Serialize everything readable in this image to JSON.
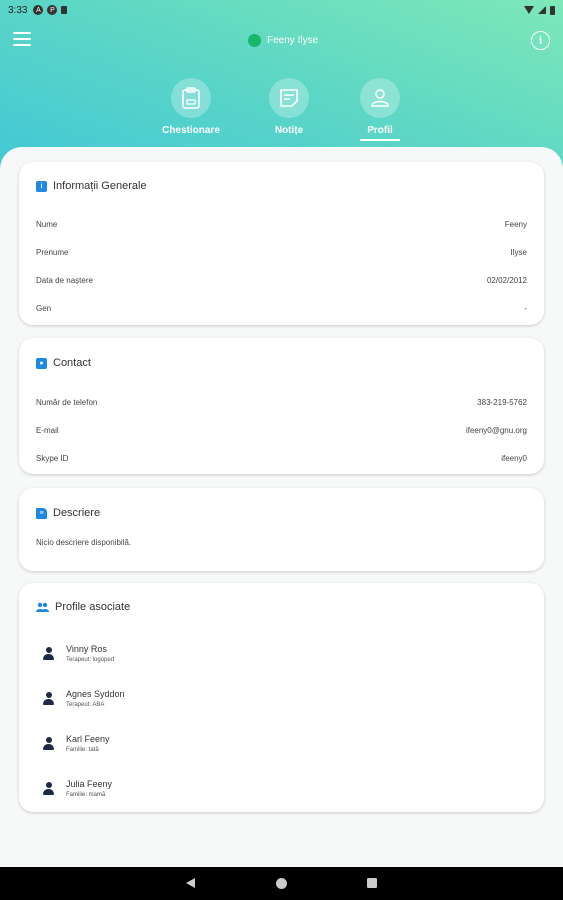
{
  "status_bar": {
    "time": "3:33"
  },
  "header": {
    "title": "Feeny Ilyse",
    "status_color": "#17b86b"
  },
  "tabs": [
    {
      "label": "Chestionare",
      "icon": "clipboard-icon",
      "active": false
    },
    {
      "label": "Notițe",
      "icon": "note-icon",
      "active": false
    },
    {
      "label": "Profil",
      "icon": "person-icon",
      "active": true
    }
  ],
  "general": {
    "title": "Informații Generale",
    "rows": [
      {
        "label": "Nume",
        "value": "Feeny"
      },
      {
        "label": "Prenume",
        "value": "Ilyse"
      },
      {
        "label": "Data de naștere",
        "value": "02/02/2012"
      },
      {
        "label": "Gen",
        "value": "-"
      }
    ]
  },
  "contact": {
    "title": "Contact",
    "rows": [
      {
        "label": "Număr de telefon",
        "value": "383-219-5762"
      },
      {
        "label": "E-mail",
        "value": "ifeeny0@gnu.org"
      },
      {
        "label": "Skype ID",
        "value": "ifeeny0"
      }
    ]
  },
  "description": {
    "title": "Descriere",
    "text": "Nicio descriere disponibilă."
  },
  "associated": {
    "title": "Profile asociate",
    "people": [
      {
        "name": "Vinny Ros",
        "role": "Terapeut: logoped"
      },
      {
        "name": "Agnes Syddon",
        "role": "Terapeut: ABA"
      },
      {
        "name": "Karl Feeny",
        "role": "Familie: tată"
      },
      {
        "name": "Julia Feeny",
        "role": "Familie: mamă"
      }
    ]
  },
  "colors": {
    "accent": "#1e88e5",
    "gradient_top": "#7ee8b8",
    "gradient_bottom": "#41c7d6"
  }
}
